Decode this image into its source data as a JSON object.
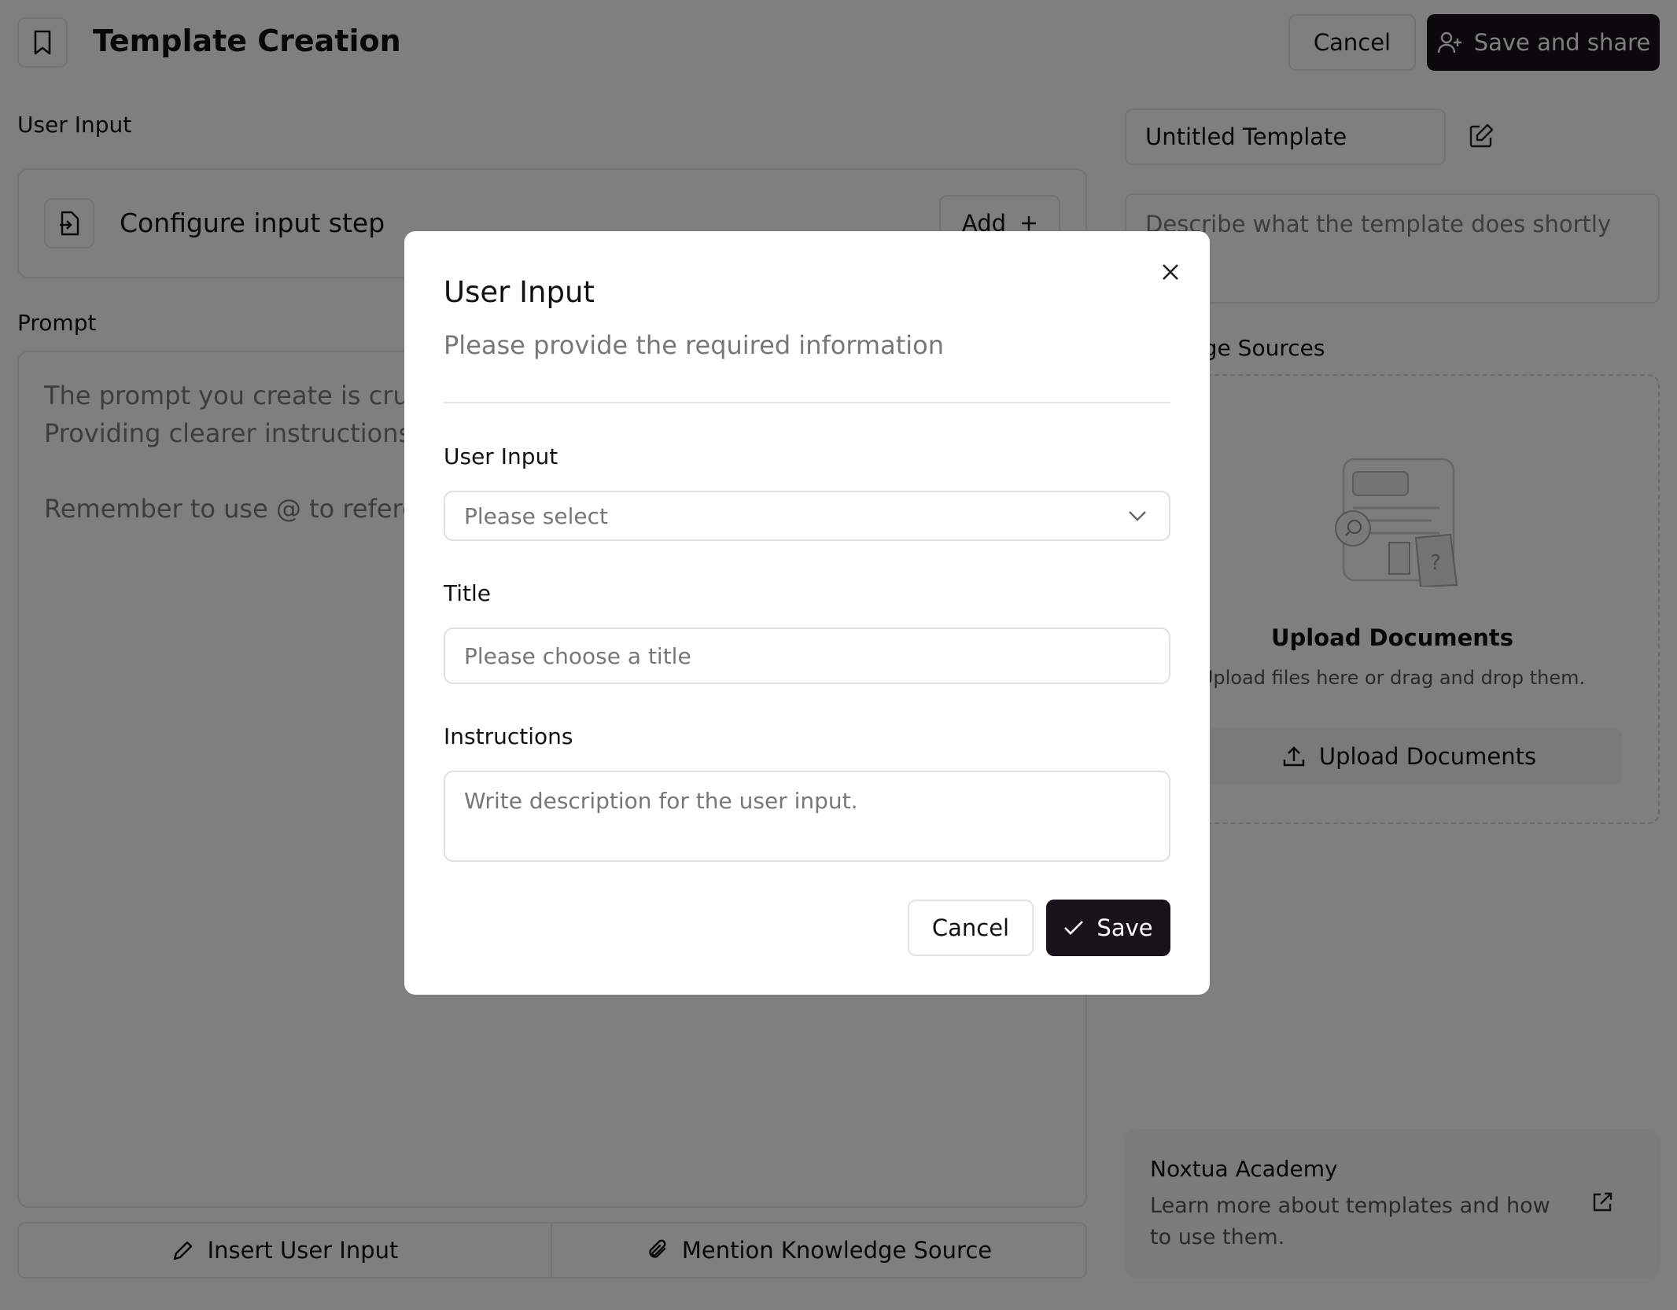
{
  "header": {
    "title": "Template Creation",
    "cancel_label": "Cancel",
    "save_share_label": "Save and share"
  },
  "left": {
    "user_input_label": "User Input",
    "configure_label": "Configure input step",
    "add_label": "Add",
    "prompt_label": "Prompt",
    "prompt_line1": "The prompt you create is cruci",
    "prompt_line2": "Providing clearer instructions w",
    "prompt_line3": "Remember to use @ to referen",
    "insert_user_input_label": "Insert User Input",
    "mention_knowledge_label": "Mention Knowledge Source"
  },
  "right": {
    "template_name": "Untitled Template",
    "description_placeholder": "Describe what the template does shortly",
    "knowledge_sources_label": "lge Sources",
    "upload_title": "Upload Documents",
    "upload_subtitle": "Upload files here or drag and drop them.",
    "upload_button_label": "Upload Documents",
    "academy_title": "Noxtua Academy",
    "academy_line1": "Learn more about templates and how",
    "academy_line2": "to use them."
  },
  "modal": {
    "title": "User Input",
    "subtitle": "Please provide the required information",
    "user_input_label": "User Input",
    "user_input_placeholder": "Please select",
    "title_label": "Title",
    "title_placeholder": "Please choose a title",
    "instructions_label": "Instructions",
    "instructions_placeholder": "Write description for the user input.",
    "cancel_label": "Cancel",
    "save_label": "Save"
  }
}
